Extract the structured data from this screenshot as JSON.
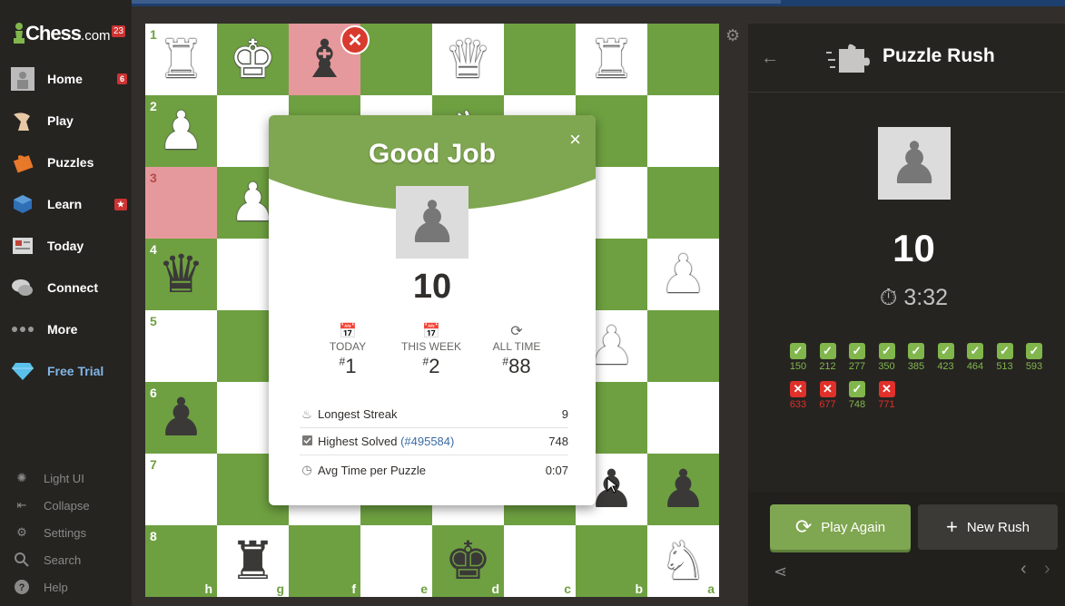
{
  "topbar": {
    "color": "#1d3f6e"
  },
  "sidebar": {
    "logo": {
      "text": "Chess",
      "suffix": ".com",
      "badge": "23"
    },
    "items": [
      {
        "label": "Home",
        "icon": "home-avatar-icon",
        "badge": "6"
      },
      {
        "label": "Play",
        "icon": "play-hand-icon",
        "badge": ""
      },
      {
        "label": "Puzzles",
        "icon": "puzzle-piece-icon",
        "badge": ""
      },
      {
        "label": "Learn",
        "icon": "learn-cube-icon",
        "badge": "★"
      },
      {
        "label": "Today",
        "icon": "newspaper-icon",
        "badge": ""
      },
      {
        "label": "Connect",
        "icon": "chat-bubbles-icon",
        "badge": ""
      },
      {
        "label": "More",
        "icon": "more-dots-icon",
        "badge": ""
      },
      {
        "label": "Free Trial",
        "icon": "diamond-icon",
        "badge": ""
      }
    ],
    "bottom": [
      {
        "label": "Light UI",
        "icon": "sun-icon"
      },
      {
        "label": "Collapse",
        "icon": "collapse-arrow-icon"
      },
      {
        "label": "Settings",
        "icon": "gear-icon"
      },
      {
        "label": "Search",
        "icon": "search-icon"
      },
      {
        "label": "Help",
        "icon": "help-icon"
      }
    ]
  },
  "board": {
    "ranks": [
      "1",
      "2",
      "3",
      "4",
      "5",
      "6",
      "7",
      "8"
    ],
    "files": [
      "h",
      "g",
      "f",
      "e",
      "d",
      "c",
      "b",
      "a"
    ],
    "colors": {
      "light": "#ffffff",
      "dark": "#6ea041",
      "highlight": "#e6999c"
    }
  },
  "modal": {
    "title": "Good Job",
    "close": "×",
    "score": "10",
    "stats": [
      {
        "label": "TODAY",
        "hash": "#",
        "value": "1",
        "icon": "calendar-icon"
      },
      {
        "label": "THIS WEEK",
        "hash": "#",
        "value": "2",
        "icon": "calendar-icon"
      },
      {
        "label": "ALL TIME",
        "hash": "#",
        "value": "88",
        "icon": "refresh-icon"
      }
    ],
    "rows": [
      {
        "label": "Longest Streak",
        "value": "9",
        "icon": "flame-icon"
      },
      {
        "label": "Highest Solved",
        "link": "(#495584)",
        "value": "748",
        "icon": "checkbox-icon"
      },
      {
        "label": "Avg Time per Puzzle",
        "value": "0:07",
        "icon": "clock-icon"
      }
    ]
  },
  "panel": {
    "title": "Puzzle Rush",
    "score": "10",
    "timer": "3:32",
    "results": [
      {
        "ok": true,
        "rating": "150"
      },
      {
        "ok": true,
        "rating": "212"
      },
      {
        "ok": true,
        "rating": "277"
      },
      {
        "ok": true,
        "rating": "350"
      },
      {
        "ok": true,
        "rating": "385"
      },
      {
        "ok": true,
        "rating": "423"
      },
      {
        "ok": true,
        "rating": "464"
      },
      {
        "ok": true,
        "rating": "513"
      },
      {
        "ok": true,
        "rating": "593"
      },
      {
        "ok": false,
        "rating": "633"
      },
      {
        "ok": false,
        "rating": "677"
      },
      {
        "ok": true,
        "rating": "748"
      },
      {
        "ok": false,
        "rating": "771"
      }
    ],
    "play_again": "Play Again",
    "new_rush": "New Rush",
    "colors": {
      "play": "#7fa650",
      "ok": "#81b64c",
      "bad": "#e0302a"
    }
  }
}
